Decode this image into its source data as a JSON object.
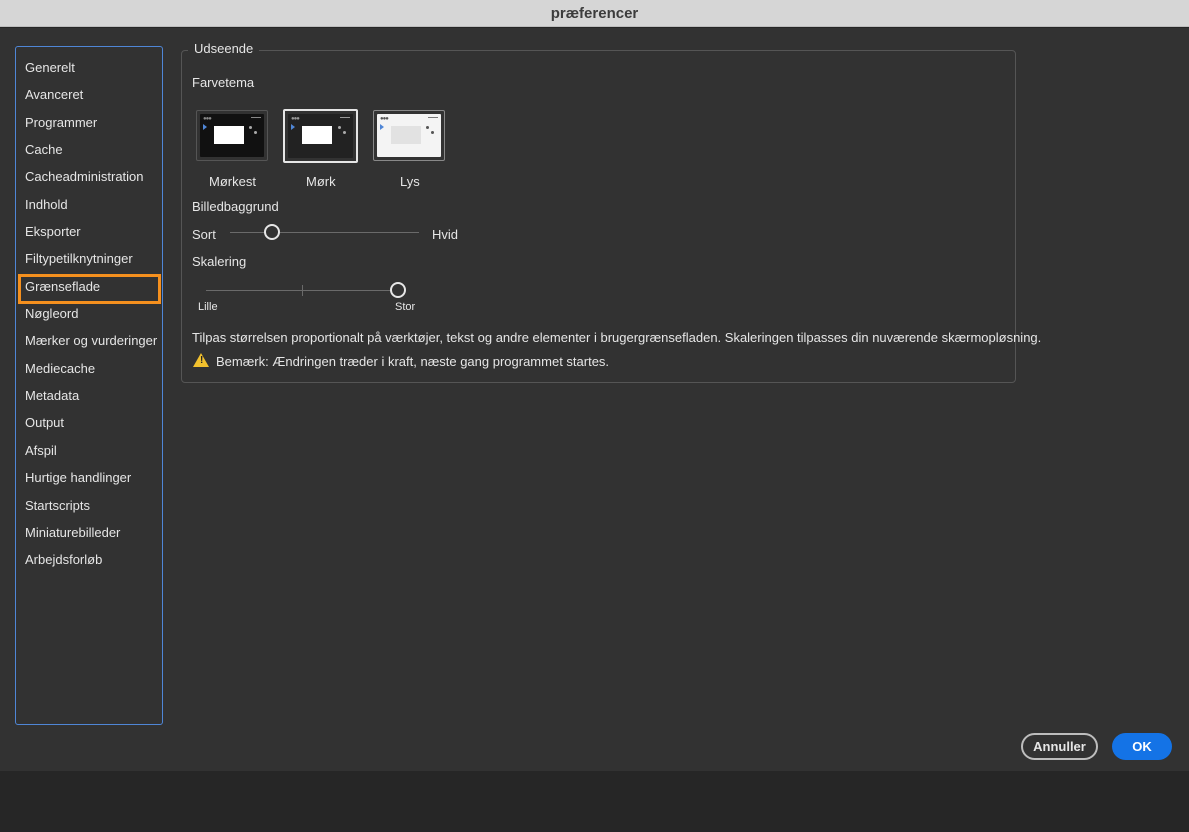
{
  "window": {
    "title": "præferencer"
  },
  "sidebar": {
    "items": [
      {
        "label": "Generelt"
      },
      {
        "label": "Avanceret"
      },
      {
        "label": "Programmer"
      },
      {
        "label": "Cache"
      },
      {
        "label": "Cacheadministration"
      },
      {
        "label": "Indhold"
      },
      {
        "label": "Eksporter"
      },
      {
        "label": "Filtypetilknytninger"
      },
      {
        "label": "Grænseflade",
        "selected": true
      },
      {
        "label": "Nøgleord"
      },
      {
        "label": "Mærker og vurderinger"
      },
      {
        "label": "Mediecache"
      },
      {
        "label": "Metadata"
      },
      {
        "label": "Output"
      },
      {
        "label": "Afspil"
      },
      {
        "label": "Hurtige handlinger"
      },
      {
        "label": "Startscripts"
      },
      {
        "label": "Miniaturebilleder"
      },
      {
        "label": "Arbejdsforløb"
      }
    ]
  },
  "appearance": {
    "group_title": "Udseende",
    "color_theme_label": "Farvetema",
    "themes": [
      {
        "label": "Mørkest"
      },
      {
        "label": "Mørk",
        "selected": true
      },
      {
        "label": "Lys"
      }
    ],
    "image_background": {
      "label": "Billedbaggrund",
      "min_label": "Sort",
      "max_label": "Hvid",
      "value_fraction": 0.22
    },
    "scaling": {
      "label": "Skalering",
      "min_label": "Lille",
      "max_label": "Stor",
      "value_fraction": 1.0
    },
    "description": "Tilpas størrelsen proportionalt på værktøjer, tekst og andre elementer i brugergrænsefladen. Skaleringen tilpasses din nuværende skærmopløsning.",
    "note": "Bemærk: Ændringen træder i kraft, næste gang programmet startes."
  },
  "buttons": {
    "cancel": "Annuller",
    "ok": "OK"
  },
  "colors": {
    "accent": "#1473e6",
    "selection_highlight": "#f5901e",
    "sidebar_border": "#4f86d6",
    "warning": "#f2c12e"
  }
}
